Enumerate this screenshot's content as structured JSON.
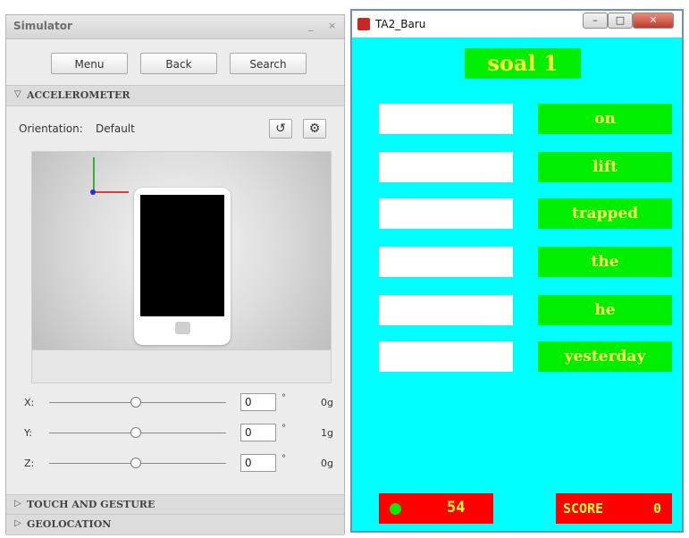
{
  "simulator": {
    "title": "Simulator",
    "minimize": "_",
    "close": "×",
    "buttons": {
      "menu": "Menu",
      "back": "Back",
      "search": "Search"
    },
    "accelerometer": {
      "label": "ACCELEROMETER",
      "orientation_label": "Orientation:",
      "orientation_value": "Default",
      "axes": [
        {
          "label": "X:",
          "value": "0",
          "unit": "°",
          "g": "0g"
        },
        {
          "label": "Y:",
          "value": "0",
          "unit": "°",
          "g": "1g"
        },
        {
          "label": "Z:",
          "value": "0",
          "unit": "°",
          "g": "0g"
        }
      ]
    },
    "sections": {
      "touch": "TOUCH AND GESTURE",
      "geolocation": "GEOLOCATION"
    }
  },
  "app": {
    "title": "TA2_Baru",
    "heading": "soal 1",
    "words": [
      "on",
      "lift",
      "trapped",
      "the",
      "he",
      "yesterday"
    ],
    "timer": "54",
    "score_label": "SCORE",
    "score_value": "0",
    "colors": {
      "background": "#00ffff",
      "word_bg": "#00ee00",
      "word_text": "#ffff66",
      "footer_bg": "#ff0000"
    }
  }
}
